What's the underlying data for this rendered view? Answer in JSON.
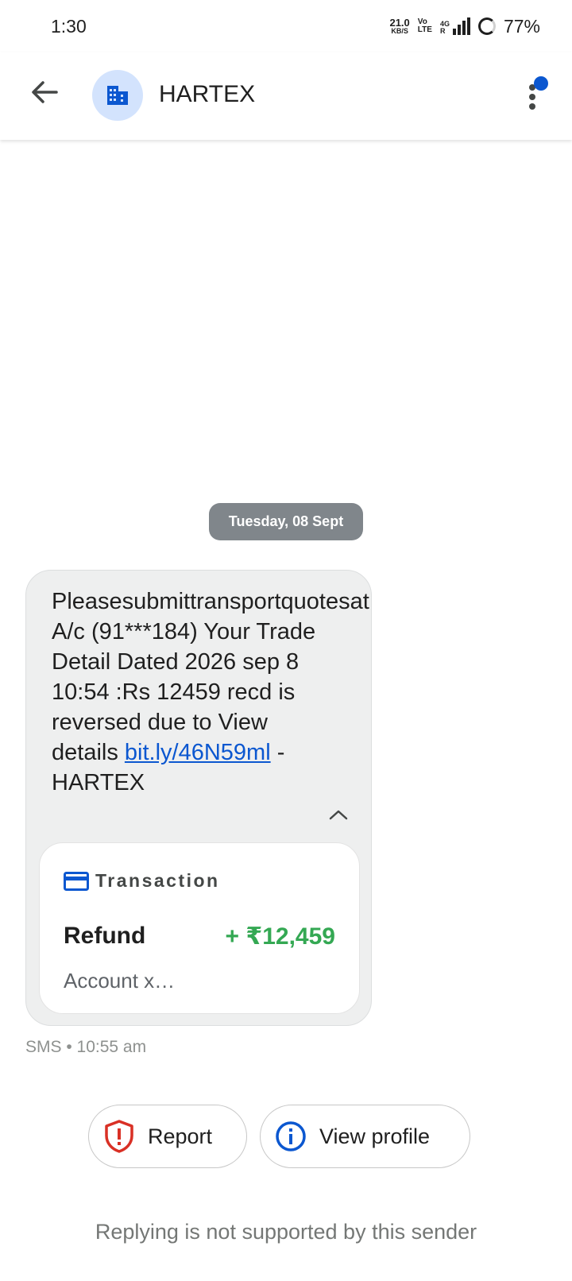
{
  "status_bar": {
    "time": "1:30",
    "net_speed_value": "21.0",
    "net_speed_unit": "KB/S",
    "volte_top": "Vo",
    "volte_bottom": "LTE",
    "network_type": "4G",
    "network_sub": "R",
    "battery": "77%"
  },
  "app_bar": {
    "sender": "HARTEX",
    "back_icon": "arrow-back-icon",
    "avatar_icon": "business-icon",
    "menu_icon": "more-vert-icon",
    "badge_color": "#0b57d0"
  },
  "conversation": {
    "date_label": "Tuesday, 08 Sept",
    "message": {
      "text_before_link": "Pleasesubmittransportquotesat  A/c (91***184) Your Trade Detail Dated 2026 sep 8 10:54 :Rs 12459 recd is reversed due to View details ",
      "link_text": "bit.ly/46N59ml",
      "text_after_link": " - HARTEX",
      "transaction": {
        "title": "Transaction",
        "type": "Refund",
        "amount": "+ ₹12,459",
        "account": "Account x…",
        "amount_color": "#34a853"
      },
      "meta": "SMS • 10:55 am"
    }
  },
  "actions": {
    "report_label": "Report",
    "view_profile_label": "View profile"
  },
  "footer": {
    "note": "Replying is not supported by this sender"
  }
}
